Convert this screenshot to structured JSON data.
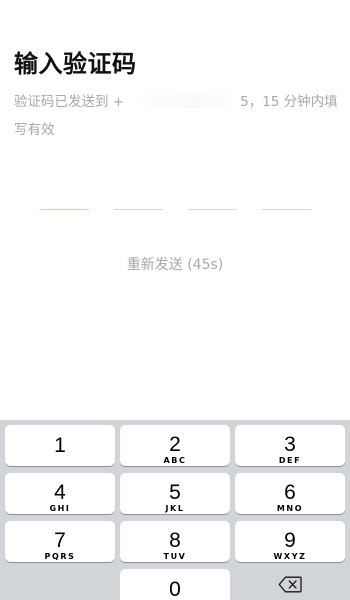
{
  "header": {
    "title": "输入验证码"
  },
  "hint": {
    "prefix": "验证码已发送到 +",
    "suffix": "5，15 分钟内填写有效"
  },
  "code": {
    "slots": 4,
    "active_index": 0
  },
  "resend": {
    "label": "重新发送 (45s)"
  },
  "keypad": {
    "keys": [
      {
        "num": "1",
        "letters": ""
      },
      {
        "num": "2",
        "letters": "ABC"
      },
      {
        "num": "3",
        "letters": "DEF"
      },
      {
        "num": "4",
        "letters": "GHI"
      },
      {
        "num": "5",
        "letters": "JKL"
      },
      {
        "num": "6",
        "letters": "MNO"
      },
      {
        "num": "7",
        "letters": "PQRS"
      },
      {
        "num": "8",
        "letters": "TUV"
      },
      {
        "num": "9",
        "letters": "WXYZ"
      },
      {
        "num": "0",
        "letters": ""
      }
    ],
    "delete_icon": "backspace-icon"
  }
}
